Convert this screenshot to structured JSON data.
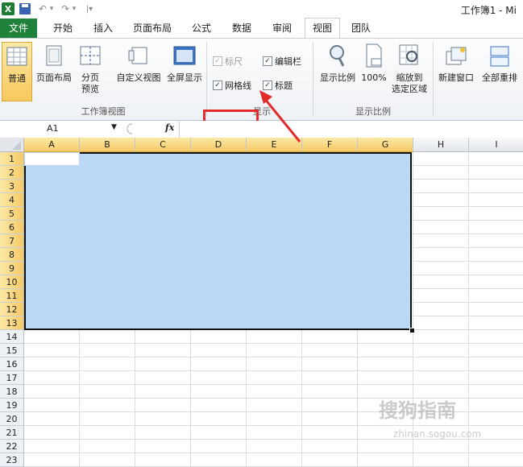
{
  "window": {
    "title": "工作簿1 - Mi"
  },
  "quick_access": {
    "undo_glyph": "↶",
    "dropdown_glyph": "▾",
    "redo_glyph": "↷",
    "customize_glyph": "|▾"
  },
  "tabs": [
    {
      "label": "文件"
    },
    {
      "label": "开始"
    },
    {
      "label": "插入"
    },
    {
      "label": "页面布局"
    },
    {
      "label": "公式"
    },
    {
      "label": "数据"
    },
    {
      "label": "审阅"
    },
    {
      "label": "视图"
    },
    {
      "label": "团队"
    }
  ],
  "active_tab": "视图",
  "ribbon": {
    "workbook_views": {
      "group_label": "工作簿视图",
      "normal": "普通",
      "page_layout": "页面布局",
      "page_break_line1": "分页",
      "page_break_line2": "预览",
      "custom_views": "自定义视图",
      "full_screen": "全屏显示"
    },
    "show": {
      "group_label": "显示",
      "ruler": {
        "label": "标尺",
        "checked": true,
        "enabled": false
      },
      "formula_bar": {
        "label": "编辑栏",
        "checked": true
      },
      "gridlines": {
        "label": "网格线",
        "checked": true
      },
      "headings": {
        "label": "标题",
        "checked": true
      }
    },
    "zoom": {
      "group_label": "显示比例",
      "zoom": "显示比例",
      "zoom_100": "100%",
      "zoom_to_selection_line1": "缩放到",
      "zoom_to_selection_line2": "选定区域"
    },
    "window": {
      "new_window": "新建窗口",
      "arrange_all": "全部重排"
    }
  },
  "formula_bar": {
    "name_box": "A1",
    "fx": "fx",
    "value": ""
  },
  "sheet": {
    "columns": [
      "A",
      "B",
      "C",
      "D",
      "E",
      "F",
      "G",
      "H",
      "I"
    ],
    "rows": [
      "1",
      "2",
      "3",
      "4",
      "5",
      "6",
      "7",
      "8",
      "9",
      "10",
      "11",
      "12",
      "13",
      "14",
      "15",
      "16",
      "17",
      "18",
      "19",
      "20",
      "21",
      "22",
      "23"
    ],
    "selection": "A1:G13"
  },
  "annotation": {
    "color": "#e32b2b"
  },
  "watermark": {
    "text": "搜狗指南",
    "sub": "zhinan.sogou.com"
  },
  "colors": {
    "file_tab": "#20813b",
    "selection_fill": "#bcd8f7",
    "selected_header": "#f5c966"
  }
}
